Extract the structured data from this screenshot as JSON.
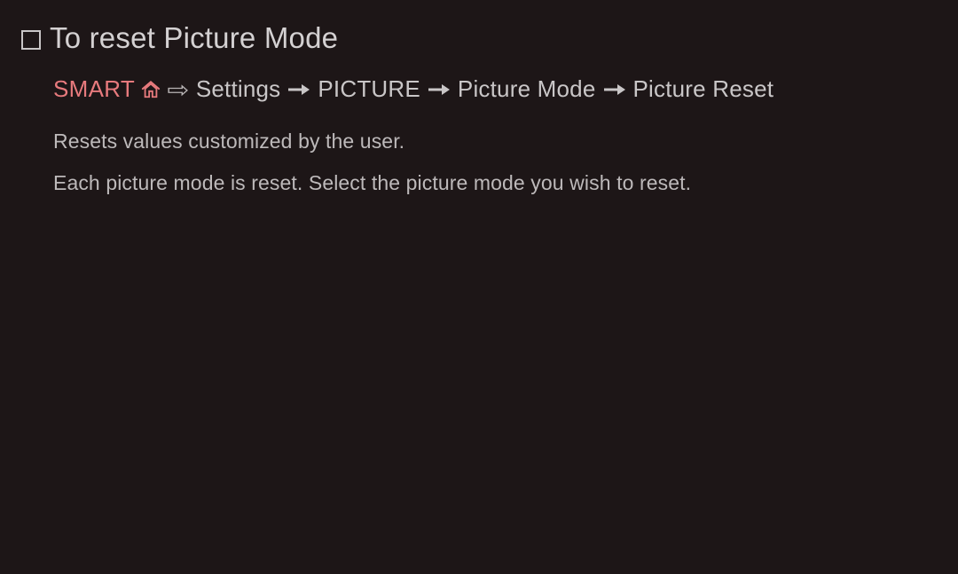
{
  "title": "To reset Picture Mode",
  "breadcrumb": {
    "smart": "SMART",
    "items": [
      "Settings",
      "PICTURE",
      "Picture Mode",
      "Picture Reset"
    ]
  },
  "body": {
    "line1": "Resets values customized by the user.",
    "line2": "Each picture mode is reset. Select the picture mode you wish to reset."
  },
  "colors": {
    "background": "#1d1617",
    "title": "#d4d1d2",
    "accent": "#e77a7d",
    "breadcrumb": "#c9c6c7",
    "body": "#bdb9ba"
  }
}
